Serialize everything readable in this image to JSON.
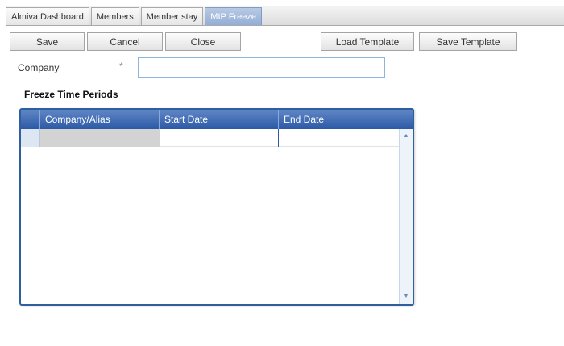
{
  "tabs": [
    {
      "label": "Almiva Dashboard",
      "active": false
    },
    {
      "label": "Members",
      "active": false
    },
    {
      "label": "Member stay",
      "active": false
    },
    {
      "label": "MIP Freeze",
      "active": true
    }
  ],
  "toolbar": {
    "save_label": "Save",
    "cancel_label": "Cancel",
    "close_label": "Close",
    "load_template_label": "Load Template",
    "save_template_label": "Save Template"
  },
  "form": {
    "company_label": "Company",
    "company_required_marker": "*",
    "company_value": ""
  },
  "section": {
    "title": "Freeze Time Periods"
  },
  "grid": {
    "columns": [
      "Company/Alias",
      "Start Date",
      "End Date"
    ],
    "rows": [
      [
        "",
        "",
        ""
      ]
    ]
  },
  "colors": {
    "accent": "#2d5aa6",
    "active_tab": "#93aed8",
    "input_border": "#8fb4d9"
  }
}
